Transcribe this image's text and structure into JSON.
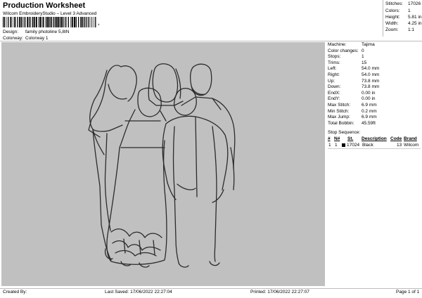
{
  "header": {
    "title": "Production Worksheet",
    "subtitle": "Wilcom EmbroideryStudio – Level 3 Advanced",
    "barcode_tick": ",",
    "design_label": "Design:",
    "design_value": "family photoline 5,8IN",
    "colorway_label": "Colorway:",
    "colorway_value": "Colorway 1"
  },
  "stats": {
    "stitches_label": "Stitches:",
    "stitches_value": "17026",
    "colors_label": "Colors:",
    "colors_value": "1",
    "height_label": "Height:",
    "height_value": "5.81 in",
    "width_label": "Width:",
    "width_value": "4.25 in",
    "zoom_label": "Zoom:",
    "zoom_value": "1:1"
  },
  "info": [
    {
      "label": "Machine:",
      "value": "Tajima"
    },
    {
      "label": "Color changes:",
      "value": "0"
    },
    {
      "label": "Stops:",
      "value": "1"
    },
    {
      "label": "Trims:",
      "value": "15"
    },
    {
      "label": "Left:",
      "value": "54.0 mm"
    },
    {
      "label": "Right:",
      "value": "54.0 mm"
    },
    {
      "label": "Up:",
      "value": "73.8 mm"
    },
    {
      "label": "Down:",
      "value": "73.8 mm"
    },
    {
      "label": "EndX:",
      "value": "0.00 in"
    },
    {
      "label": "EndY:",
      "value": "0.00 in"
    },
    {
      "label": "Max Stitch:",
      "value": "6.9 mm"
    },
    {
      "label": "Min Stitch:",
      "value": "0.2 mm"
    },
    {
      "label": "Max Jump:",
      "value": "6.9 mm"
    },
    {
      "label": "Total Bobbin:",
      "value": "45.59ft"
    }
  ],
  "sequence": {
    "title": "Stop Sequence:",
    "columns": [
      "#",
      "N#",
      "St.",
      "Description",
      "Code",
      "Brand"
    ],
    "rows": [
      {
        "num": "1",
        "needle": "1",
        "stitches": "17024",
        "description": "Black",
        "code": "13",
        "brand": "Wilcom",
        "color": "#000000"
      }
    ]
  },
  "footer": {
    "created_by": "Created By:",
    "last_saved": "Last Saved: 17/06/2022 22:27:04",
    "printed": "Printed: 17/06/2022 22:27:07",
    "page": "Page 1 of 1"
  },
  "colors": {
    "canvas": "#c0c0c0",
    "thread": "#2b2b2b"
  }
}
